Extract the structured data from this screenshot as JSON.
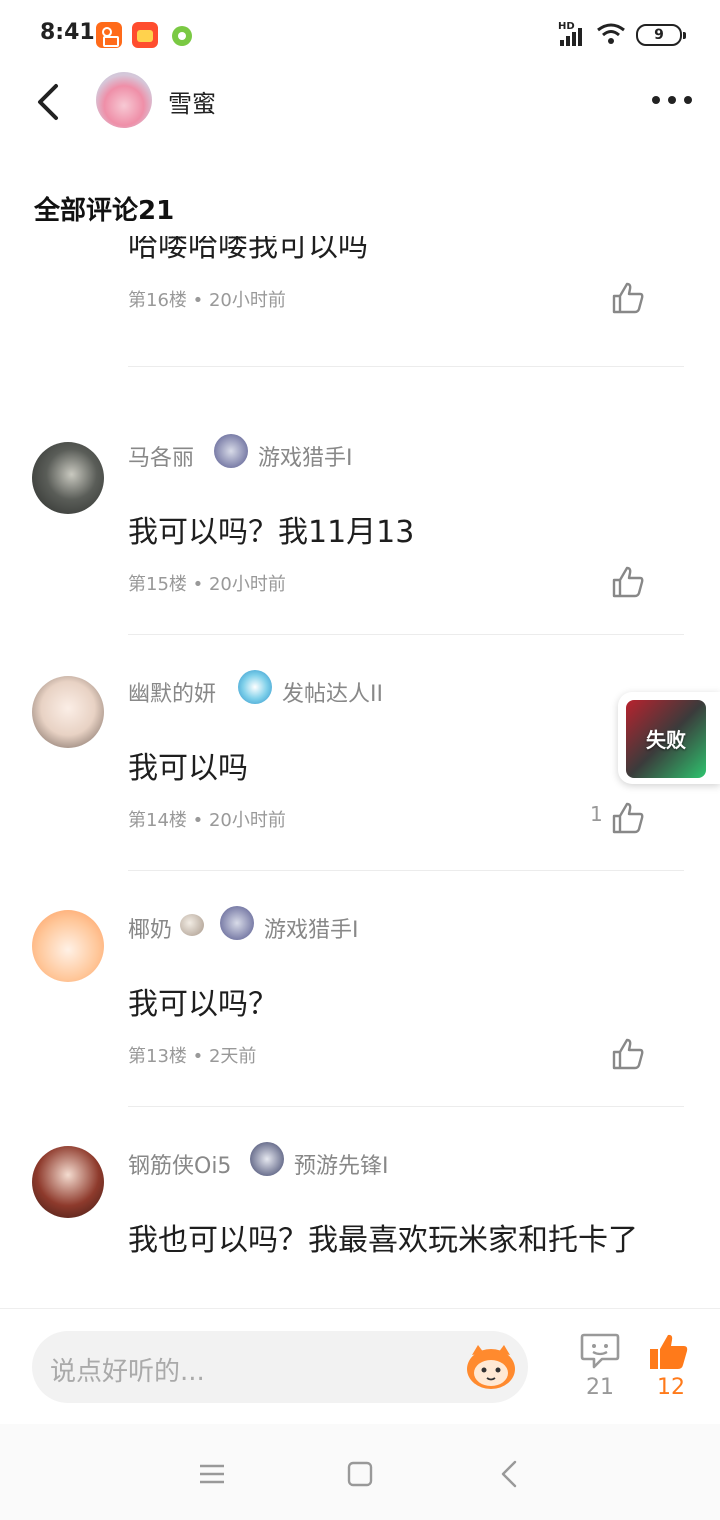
{
  "status_bar": {
    "time": "8:41",
    "signal_label": "HD",
    "battery": "9"
  },
  "header": {
    "name": "雪蜜"
  },
  "section_title": "全部评论21",
  "comments": [
    {
      "user": "",
      "badge": "",
      "text": "哈喽哈喽我可以吗",
      "meta": "第16楼 • 20小时前",
      "likes": ""
    },
    {
      "user": "马各丽",
      "badge": "游戏猎手I",
      "text": "我可以吗？我11月13",
      "meta": "第15楼 • 20小时前",
      "likes": ""
    },
    {
      "user": "幽默的妍",
      "badge": "发帖达人II",
      "text": "我可以吗",
      "meta": "第14楼 • 20小时前",
      "likes": "1"
    },
    {
      "user": "椰奶",
      "badge": "游戏猎手I",
      "text": "我可以吗？",
      "meta": "第13楼 • 2天前",
      "likes": ""
    },
    {
      "user": "钢筋侠Oi5",
      "badge": "预游先锋I",
      "text": "我也可以吗？我最喜欢玩米家和托卡了",
      "meta": "",
      "likes": ""
    }
  ],
  "float_card": {
    "label": "失败"
  },
  "bottom_bar": {
    "input_placeholder": "说点好听的...",
    "comment_count": "21",
    "like_count": "12"
  },
  "colors": {
    "accent": "#ff7a1a",
    "muted_text": "#999999"
  },
  "icons": [
    "back-icon",
    "more-icon",
    "like-icon",
    "comment-icon",
    "thumb-up-filled-icon",
    "menu-icon",
    "home-icon",
    "nav-back-icon"
  ]
}
